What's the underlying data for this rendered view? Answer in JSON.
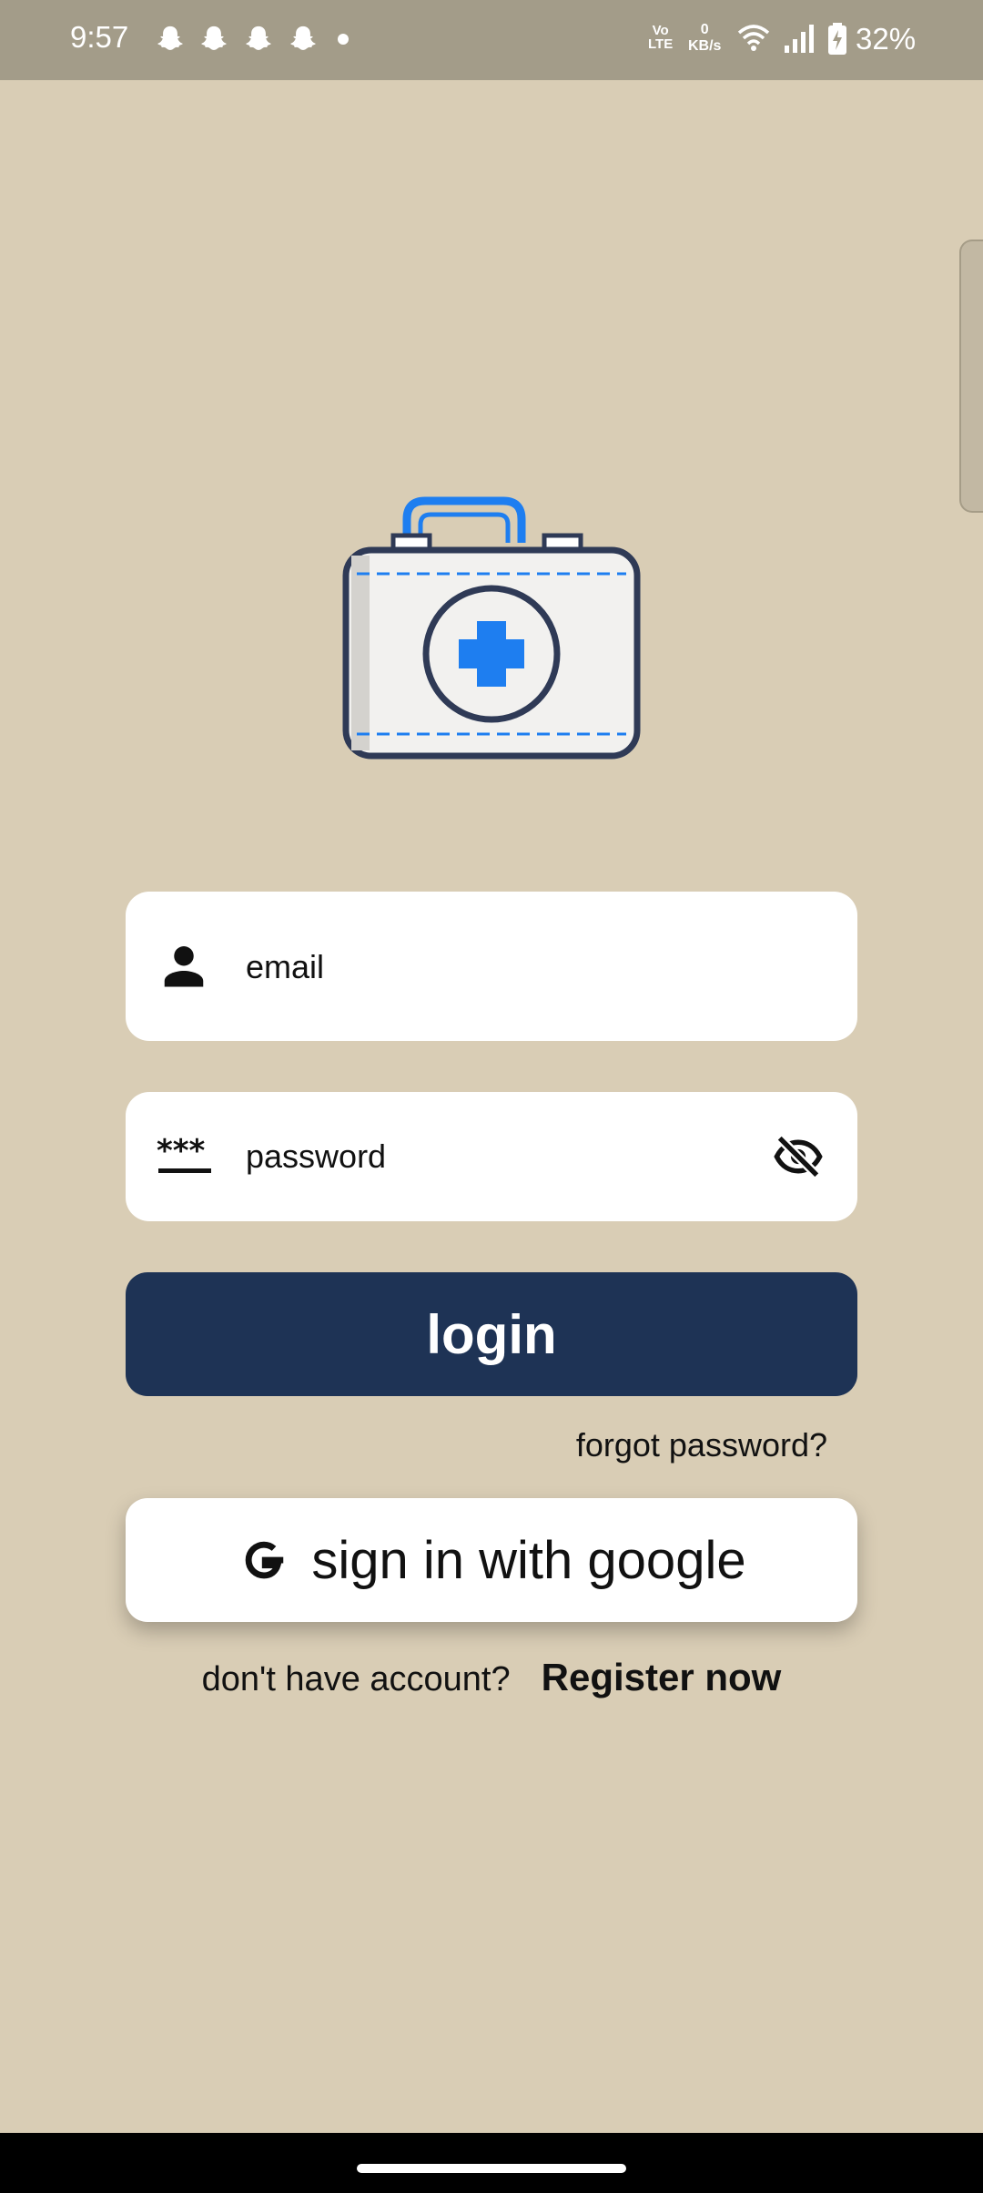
{
  "status_bar": {
    "time": "9:57",
    "volte_line1": "VoLTE",
    "netspeed_value": "0",
    "netspeed_unit": "KB/s",
    "battery": "32%",
    "notification_icons": [
      "snapchat-icon",
      "snapchat-icon",
      "snapchat-icon",
      "snapchat-icon",
      "more-dot-icon"
    ]
  },
  "logo": {
    "icon": "first-aid-kit-icon",
    "accent": "#1e7ef0",
    "outline": "#2f3a56"
  },
  "form": {
    "email_placeholder": "email",
    "password_placeholder": "password",
    "email_icon": "person-icon",
    "password_icon": "password-dots-icon",
    "visibility_icon": "eye-off-icon"
  },
  "actions": {
    "login_label": "login",
    "forgot_label": "forgot password?",
    "google_label": "sign in with google",
    "no_account_label": "don't have account?",
    "register_label": "Register now"
  },
  "colors": {
    "background": "#d9cdb5",
    "status_bar": "#a39c89",
    "login_button": "#1e3355"
  }
}
